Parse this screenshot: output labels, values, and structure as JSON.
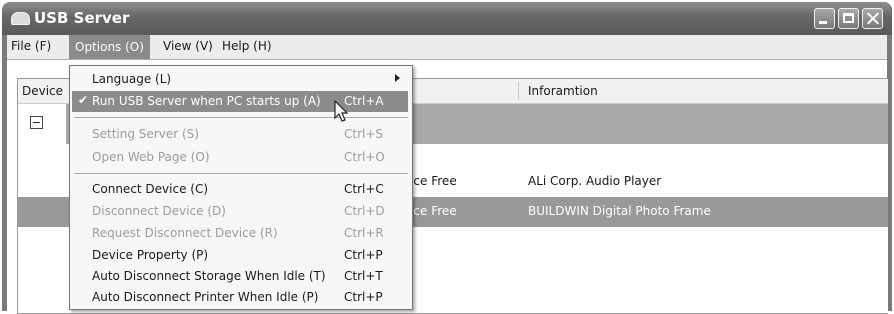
{
  "window": {
    "title": "USB Server"
  },
  "menubar": {
    "items": [
      {
        "label": "File (F)"
      },
      {
        "label": "Options (O)"
      },
      {
        "label": "View (V)"
      },
      {
        "label": "Help (H)"
      }
    ]
  },
  "listview": {
    "columns": [
      {
        "label": "Device"
      },
      {
        "label": "Inforamtion"
      }
    ],
    "rows": [
      {
        "status": "vice Free",
        "info": "ALi Corp. Audio Player"
      },
      {
        "status": "vice Free",
        "info": "BUILDWIN Digital Photo Frame"
      }
    ]
  },
  "options_menu": {
    "items": [
      {
        "label": "Language (L)",
        "shortcut": ""
      },
      {
        "label": "Run USB Server when PC starts up (A)",
        "shortcut": "Ctrl+A",
        "checked": true
      },
      {
        "label": "Setting Server (S)",
        "shortcut": "Ctrl+S"
      },
      {
        "label": "Open Web Page (O)",
        "shortcut": "Ctrl+O"
      },
      {
        "label": "Connect Device (C)",
        "shortcut": "Ctrl+C"
      },
      {
        "label": "Disconnect Device  (D)",
        "shortcut": "Ctrl+D"
      },
      {
        "label": "Request Disconnect Device  (R)",
        "shortcut": "Ctrl+R"
      },
      {
        "label": "Device Property  (P)",
        "shortcut": "Ctrl+P"
      },
      {
        "label": "Auto Disconnect Storage When Idle  (T)",
        "shortcut": "Ctrl+T"
      },
      {
        "label": "Auto Disconnect Printer When Idle  (P)",
        "shortcut": "Ctrl+P"
      }
    ]
  },
  "icons": {
    "app": "usb-server-app-icon",
    "check": "✔",
    "submenu": "chevron-right-icon",
    "expander": "collapse-minus-icon"
  }
}
